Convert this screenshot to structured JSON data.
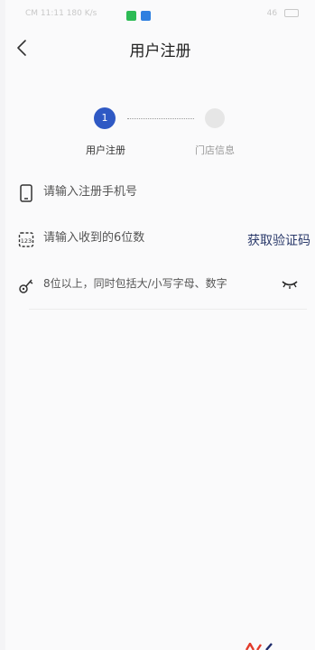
{
  "status_bar": {
    "left_text": "CM 11:11 180 K/s",
    "right_text": "46"
  },
  "header": {
    "title": "用户注册"
  },
  "stepper": {
    "steps": [
      {
        "number": "1",
        "label": "用户注册",
        "active": true
      },
      {
        "number": "",
        "label": "门店信息",
        "active": false
      }
    ],
    "active_color": "#2f59c4"
  },
  "form": {
    "phone": {
      "placeholder": "请输入注册手机号",
      "value": ""
    },
    "code": {
      "placeholder": "请输入收到的6位数",
      "value": "",
      "get_code_label": "获取验证码"
    },
    "password": {
      "placeholder": "8位以上，同时包括大/小写字母、数字",
      "value": ""
    }
  },
  "icons": {
    "back": "chevron-left-icon",
    "phone": "phone-icon",
    "code": "calendar-icon",
    "password": "key-icon",
    "visibility": "eye-closed-icon"
  }
}
